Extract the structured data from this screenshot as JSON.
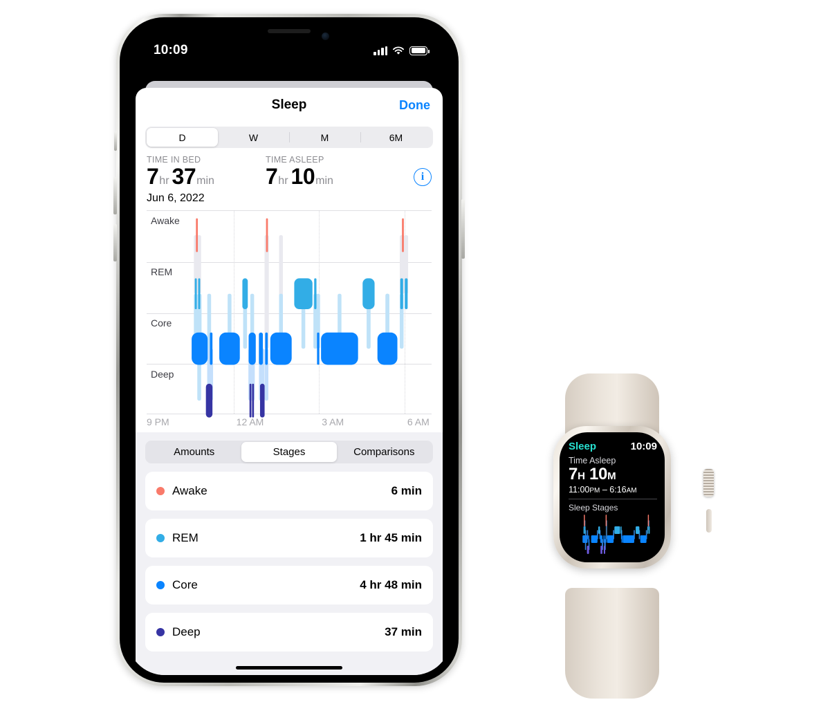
{
  "phone": {
    "status_bar": {
      "time": "10:09",
      "signal_icon": "cellular-bars-icon",
      "wifi_icon": "wifi-icon",
      "battery_icon": "battery-icon"
    },
    "nav": {
      "title": "Sleep",
      "done_label": "Done"
    },
    "range_segmented": {
      "options": [
        "D",
        "W",
        "M",
        "6M"
      ],
      "selected": "D"
    },
    "stats": {
      "time_in_bed": {
        "label": "TIME IN BED",
        "hours": "7",
        "hours_unit": "hr",
        "minutes": "37",
        "minutes_unit": "min"
      },
      "time_asleep": {
        "label": "TIME ASLEEP",
        "hours": "7",
        "hours_unit": "hr",
        "minutes": "10",
        "minutes_unit": "min"
      },
      "info_icon": "info-circle-icon"
    },
    "date_label": "Jun 6, 2022",
    "view_segmented": {
      "options": [
        "Amounts",
        "Stages",
        "Comparisons"
      ],
      "selected": "Stages"
    },
    "stage_list": [
      {
        "name": "Awake",
        "value": "6 min",
        "color": "#F97A6A"
      },
      {
        "name": "REM",
        "value": "1 hr 45 min",
        "color": "#32ADE6"
      },
      {
        "name": "Core",
        "value": "4 hr 48 min",
        "color": "#0A84FF"
      },
      {
        "name": "Deep",
        "value": "37 min",
        "color": "#3634A3"
      }
    ]
  },
  "watch": {
    "app_name": "Sleep",
    "time": "10:09",
    "subtitle": "Time Asleep",
    "duration_hours": "7",
    "duration_hours_unit": "H",
    "duration_minutes": "10",
    "duration_minutes_unit": "M",
    "range_start": "11:00",
    "range_start_period": "PM",
    "range_dash": " – ",
    "range_end": "6:16",
    "range_end_period": "AM",
    "stages_label": "Sleep Stages",
    "accent_color": "#27E0D0"
  },
  "chart_data": {
    "type": "bar",
    "title": "Sleep Stages",
    "subtitle": "Jun 6, 2022",
    "xlabel": "",
    "ylabel": "",
    "grid": true,
    "legend_position": "below-as-list",
    "bands": [
      "Awake",
      "REM",
      "Core",
      "Deep"
    ],
    "band_colors": {
      "Awake": "#F97A6A",
      "REM": "#32ADE6",
      "Core": "#0A84FF",
      "Deep": "#3634A3"
    },
    "x_ticks": [
      "9 PM",
      "12 AM",
      "3 AM",
      "6 AM"
    ],
    "x_tick_positions_pct": [
      0,
      30.5,
      60.5,
      90.5
    ],
    "xlim": [
      "9:00 PM",
      "6:45 AM"
    ],
    "totals": {
      "Awake": "6 min",
      "REM": "1 hr 45 min",
      "Core": "4 hr 48 min",
      "Deep": "37 min",
      "time_in_bed": "7 hr 37 min",
      "time_asleep": "7 hr 10 min"
    },
    "segments": [
      {
        "stage": "Core",
        "x_pct": 15.8,
        "w_pct": 5.6
      },
      {
        "stage": "Core",
        "x_pct": 22.2,
        "w_pct": 0.9
      },
      {
        "stage": "REM",
        "x_pct": 16.9,
        "w_pct": 0.7
      },
      {
        "stage": "REM",
        "x_pct": 18.1,
        "w_pct": 0.7
      },
      {
        "stage": "Awake",
        "x_pct": 17.3,
        "w_pct": 0.6
      },
      {
        "stage": "Deep",
        "x_pct": 20.8,
        "w_pct": 2.3
      },
      {
        "stage": "Core",
        "x_pct": 25.5,
        "w_pct": 7.2
      },
      {
        "stage": "REM",
        "x_pct": 33.6,
        "w_pct": 1.9
      },
      {
        "stage": "Core",
        "x_pct": 35.8,
        "w_pct": 2.5
      },
      {
        "stage": "Core",
        "x_pct": 39.4,
        "w_pct": 1.4
      },
      {
        "stage": "Deep",
        "x_pct": 36.1,
        "w_pct": 0.5
      },
      {
        "stage": "Deep",
        "x_pct": 37.0,
        "w_pct": 0.5
      },
      {
        "stage": "Deep",
        "x_pct": 39.8,
        "w_pct": 1.6
      },
      {
        "stage": "Awake",
        "x_pct": 41.9,
        "w_pct": 0.6
      },
      {
        "stage": "Core",
        "x_pct": 41.6,
        "w_pct": 0.9
      },
      {
        "stage": "Core",
        "x_pct": 43.4,
        "w_pct": 7.5
      },
      {
        "stage": "REM",
        "x_pct": 51.8,
        "w_pct": 6.4
      },
      {
        "stage": "REM",
        "x_pct": 58.8,
        "w_pct": 0.8
      },
      {
        "stage": "Core",
        "x_pct": 59.8,
        "w_pct": 0.8
      },
      {
        "stage": "Core",
        "x_pct": 61.2,
        "w_pct": 13.0
      },
      {
        "stage": "REM",
        "x_pct": 75.8,
        "w_pct": 4.2
      },
      {
        "stage": "Core",
        "x_pct": 81.0,
        "w_pct": 7.0
      },
      {
        "stage": "REM",
        "x_pct": 89.0,
        "w_pct": 1.0
      },
      {
        "stage": "REM",
        "x_pct": 90.6,
        "w_pct": 1.0
      },
      {
        "stage": "Awake",
        "x_pct": 89.6,
        "w_pct": 0.6
      }
    ]
  }
}
